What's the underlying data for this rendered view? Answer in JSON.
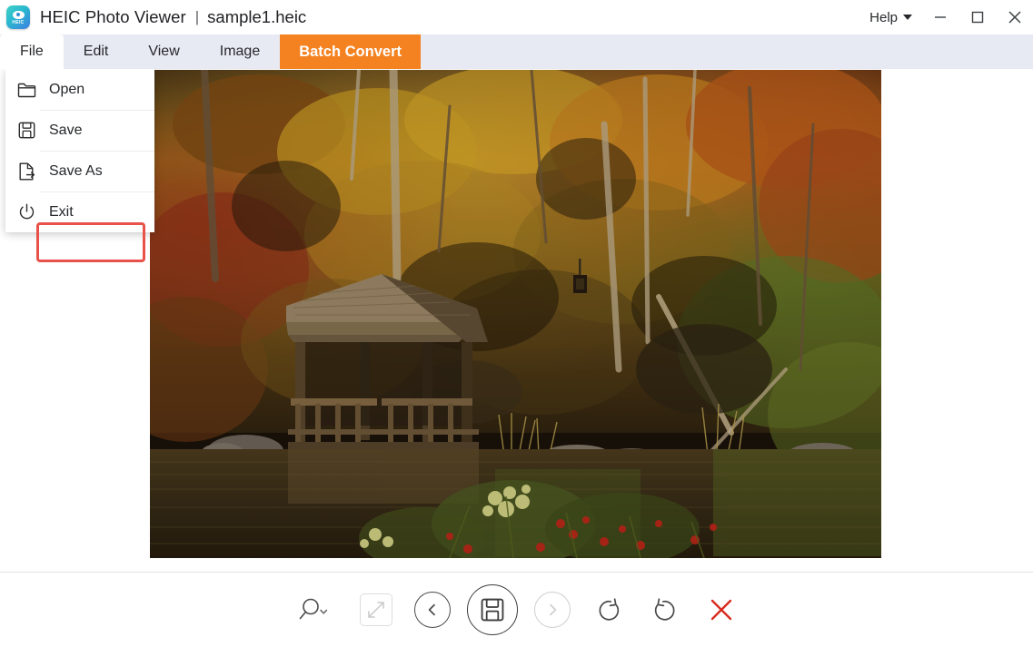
{
  "window": {
    "app_icon_label": "HEIC",
    "app_title": "HEIC Photo Viewer",
    "title_separator": "|",
    "file_name": "sample1.heic",
    "help_label": "Help",
    "controls": {
      "minimize": "minimize-icon",
      "maximize": "maximize-icon",
      "close": "close-icon"
    }
  },
  "menubar": {
    "items": [
      {
        "label": "File",
        "active": true,
        "accent": false
      },
      {
        "label": "Edit",
        "active": false,
        "accent": false
      },
      {
        "label": "View",
        "active": false,
        "accent": false
      },
      {
        "label": "Image",
        "active": false,
        "accent": false
      },
      {
        "label": "Batch Convert",
        "active": false,
        "accent": true
      }
    ],
    "accent_color": "#f58220",
    "bar_color": "#e7eaf3"
  },
  "file_menu": {
    "open_label": "Open",
    "save_label": "Save",
    "save_as_label": "Save As",
    "exit_label": "Exit",
    "highlight_color": "#e8524a",
    "highlighted_item": "Save As"
  },
  "photo": {
    "alt": "Autumn forest scene with wooden gazebo beside a reflecting pond",
    "colors": {
      "canopy_gold": "#d79a25",
      "canopy_orange": "#c0601c",
      "canopy_red": "#8e2f1c",
      "foliage_green": "#5f6b28",
      "wood": "#6e5438",
      "water": "#3a2e1b",
      "dark": "#231a10"
    }
  },
  "toolbar": {
    "buttons": [
      {
        "name": "zoom-button",
        "label": "zoom-icon",
        "disabled": false
      },
      {
        "name": "fullscreen-button",
        "label": "expand-icon",
        "disabled": true
      },
      {
        "name": "previous-button",
        "label": "chevron-left-icon",
        "disabled": false
      },
      {
        "name": "save-button",
        "label": "floppy-disk-icon",
        "disabled": false
      },
      {
        "name": "next-button",
        "label": "chevron-right-icon",
        "disabled": true
      },
      {
        "name": "rotate-left-button",
        "label": "rotate-ccw-icon",
        "disabled": false
      },
      {
        "name": "rotate-right-button",
        "label": "rotate-cw-icon",
        "disabled": false
      },
      {
        "name": "delete-button",
        "label": "red-x-icon",
        "disabled": false
      }
    ],
    "delete_color": "#d92b20"
  }
}
